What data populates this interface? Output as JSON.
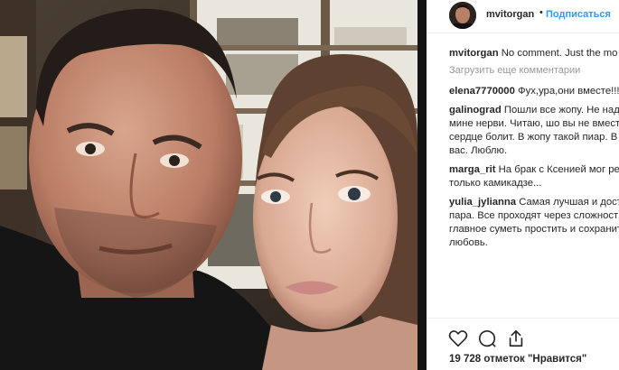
{
  "post": {
    "username": "mvitorgan",
    "separator": "•",
    "follow_label": "Подписаться",
    "caption_user": "mvitorgan",
    "caption_text": "No comment. Just the mo",
    "load_more": "Загрузить еще комментарии",
    "likes": "19 728 отметок \"Нравится\""
  },
  "comments": [
    {
      "user": "elena7770000",
      "lines": [
        "Фух,ура,они вместе!!!"
      ]
    },
    {
      "user": "galinograd",
      "lines": [
        "Пошли все жопу. Не над",
        "мине нерви. Читаю, шо вы не вмест",
        "сердце болит. В жопу такой пиар. В",
        "вас. Люблю."
      ]
    },
    {
      "user": "marga_rit",
      "lines": [
        "На брак с Ксенией мог реш",
        "только камикадзе..."
      ]
    },
    {
      "user": "yulia_jylianna",
      "lines": [
        "Самая лучшая и досто",
        "пара. Все проходят через сложност",
        "главное суметь простить и сохранит",
        "любовь."
      ]
    }
  ],
  "icons": [
    "heart-icon",
    "comment-icon",
    "share-icon"
  ],
  "colors": {
    "link": "#3897f0",
    "text": "#262626",
    "muted": "#999999"
  }
}
